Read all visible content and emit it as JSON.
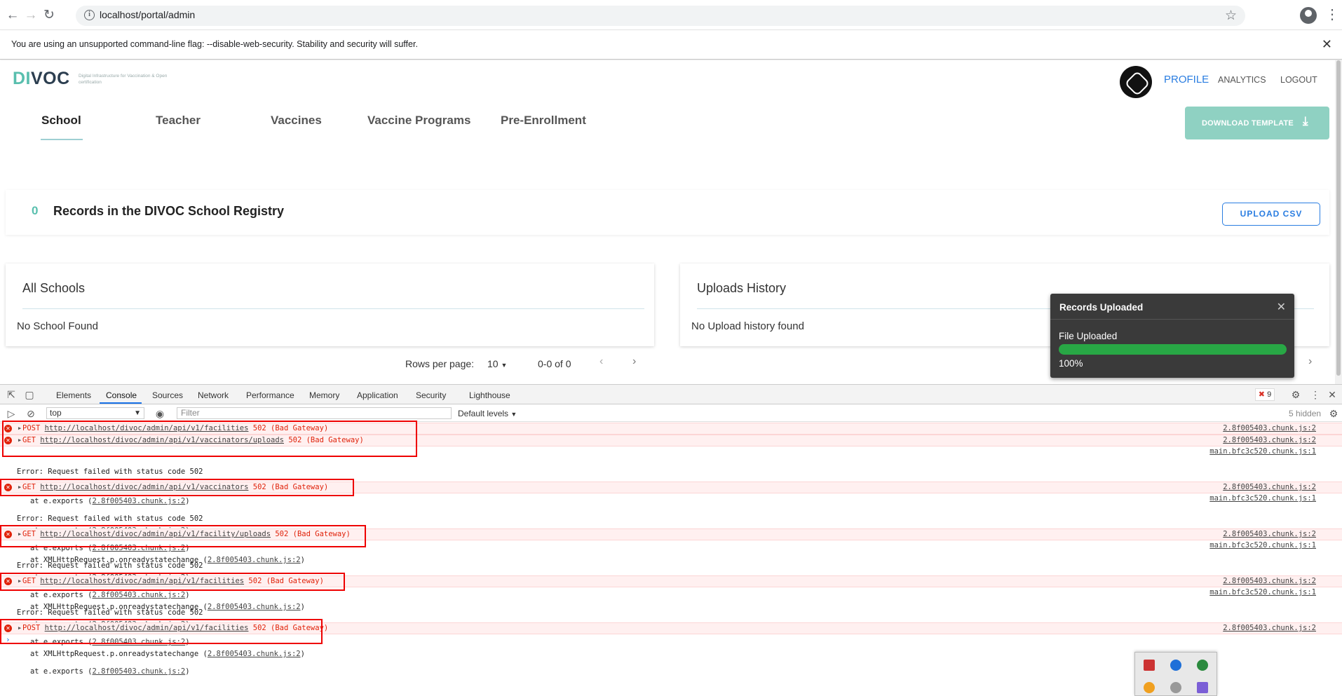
{
  "browser": {
    "url": "localhost/portal/admin",
    "warning": "You are using an unsupported command-line flag: --disable-web-security. Stability and security will suffer."
  },
  "header": {
    "logo_di": "DI",
    "logo_voc": "VOC",
    "logo_tagline": "Digital Infrastructure for Vaccination & Open certification",
    "nav": {
      "profile": "PROFILE",
      "analytics": "ANALYTICS",
      "logout": "LOGOUT"
    }
  },
  "tabs": [
    "School",
    "Teacher",
    "Vaccines",
    "Vaccine Programs",
    "Pre-Enrollment"
  ],
  "download_template_label": "DOWNLOAD TEMPLATE",
  "records": {
    "count": "0",
    "title": "Records in the DIVOC School Registry",
    "upload_label": "UPLOAD CSV"
  },
  "panels": {
    "schools": {
      "title": "All Schools",
      "empty": "No School Found"
    },
    "uploads": {
      "title": "Uploads History",
      "empty": "No Upload history found"
    }
  },
  "pagination": {
    "rows_label": "Rows per page:",
    "rows_value": "10",
    "range": "0-0 of 0"
  },
  "toast": {
    "title": "Records Uploaded",
    "file_label": "File Uploaded",
    "percent": "100%",
    "progress": 1.0
  },
  "devtools": {
    "tabs": [
      "Elements",
      "Console",
      "Sources",
      "Network",
      "Performance",
      "Memory",
      "Application",
      "Security",
      "Lighthouse"
    ],
    "error_count": "9",
    "context": "top",
    "filter_placeholder": "Filter",
    "levels": "Default levels",
    "hidden": "5 hidden",
    "messages": [
      {
        "method": "POST",
        "url": "http://localhost/divoc/admin/api/v1/facilities",
        "status": "502 (Bad Gateway)",
        "source": "2.8f005403.chunk.js:2"
      },
      {
        "method": "GET",
        "url": "http://localhost/divoc/admin/api/v1/vaccinators/uploads",
        "status": "502 (Bad Gateway)",
        "source": "2.8f005403.chunk.js:2"
      },
      {
        "method": "GET",
        "url": "http://localhost/divoc/admin/api/v1/vaccinators",
        "status": "502 (Bad Gateway)",
        "source": "2.8f005403.chunk.js:2"
      },
      {
        "method": "GET",
        "url": "http://localhost/divoc/admin/api/v1/facility/uploads",
        "status": "502 (Bad Gateway)",
        "source": "2.8f005403.chunk.js:2"
      },
      {
        "method": "GET",
        "url": "http://localhost/divoc/admin/api/v1/facilities",
        "status": "502 (Bad Gateway)",
        "source": "2.8f005403.chunk.js:2"
      },
      {
        "method": "POST",
        "url": "http://localhost/divoc/admin/api/v1/facilities",
        "status": "502 (Bad Gateway)",
        "source": "2.8f005403.chunk.js:2"
      }
    ],
    "trace": {
      "error": "Error: Request failed with status code 502",
      "at_prefix": "at e.exports (",
      "chunk": "2.8f005403.chunk.js:2",
      "xhr": "at XMLHttpRequest.p.onreadystatechange (",
      "source": "main.bfc3c520.chunk.js:1"
    }
  }
}
